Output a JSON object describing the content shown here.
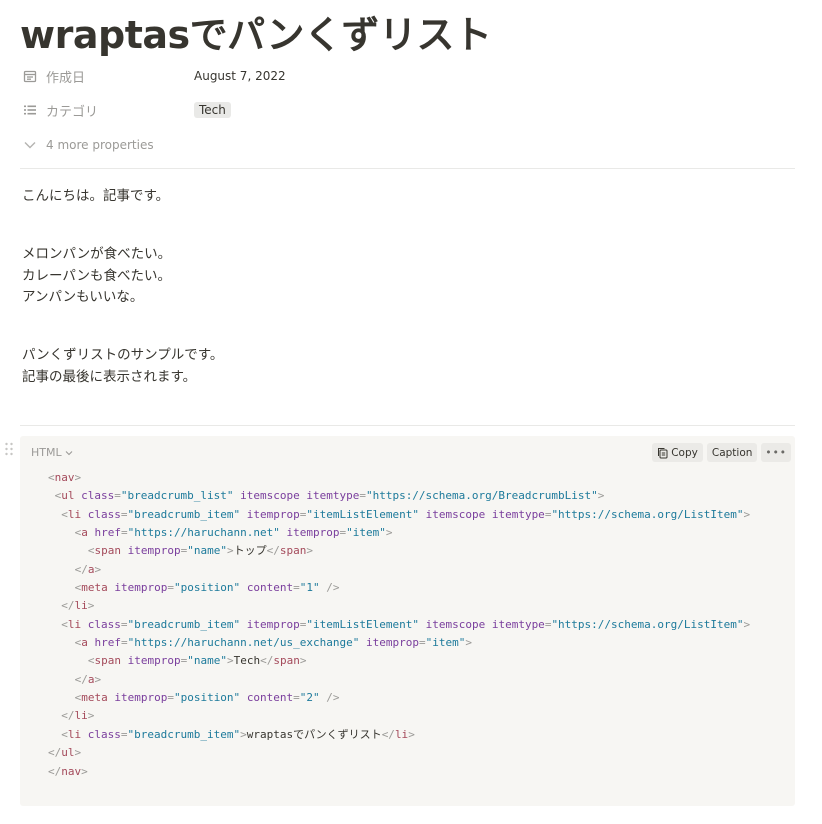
{
  "page": {
    "title": "wraptasでパンくずリスト"
  },
  "properties": {
    "created": {
      "icon": "calendar-icon",
      "name": "作成日",
      "value": "August 7, 2022"
    },
    "category": {
      "icon": "list-icon",
      "name": "カテゴリ",
      "tag": "Tech"
    },
    "more": {
      "icon": "chevron-down-icon",
      "label": "4 more properties"
    }
  },
  "content": {
    "p1": "こんにちは。記事です。",
    "p2": [
      "メロンパンが食べたい。",
      "カレーパンも食べたい。",
      "アンパンもいいな。"
    ],
    "p3": [
      "パンくずリストのサンプルです。",
      "記事の最後に表示されます。"
    ]
  },
  "code_block": {
    "language": "HTML",
    "copy_label": "Copy",
    "caption_label": "Caption",
    "more_label": "•••",
    "lines": [
      {
        "indent": 0,
        "tokens": [
          [
            "pun",
            "<"
          ],
          [
            "tag",
            "nav"
          ],
          [
            "pun",
            ">"
          ]
        ]
      },
      {
        "indent": 1,
        "tokens": [
          [
            "pun",
            "<"
          ],
          [
            "tag",
            "ul"
          ],
          [
            "txt",
            " "
          ],
          [
            "attr",
            "class"
          ],
          [
            "pun",
            "="
          ],
          [
            "val",
            "\"breadcrumb_list\""
          ],
          [
            "txt",
            " "
          ],
          [
            "attr",
            "itemscope"
          ],
          [
            "txt",
            " "
          ],
          [
            "attr",
            "itemtype"
          ],
          [
            "pun",
            "="
          ],
          [
            "val",
            "\"https://schema.org/BreadcrumbList\""
          ],
          [
            "pun",
            ">"
          ]
        ]
      },
      {
        "indent": 2,
        "tokens": [
          [
            "pun",
            "<"
          ],
          [
            "tag",
            "li"
          ],
          [
            "txt",
            " "
          ],
          [
            "attr",
            "class"
          ],
          [
            "pun",
            "="
          ],
          [
            "val",
            "\"breadcrumb_item\""
          ],
          [
            "txt",
            " "
          ],
          [
            "attr",
            "itemprop"
          ],
          [
            "pun",
            "="
          ],
          [
            "val",
            "\"itemListElement\""
          ],
          [
            "txt",
            " "
          ],
          [
            "attr",
            "itemscope"
          ],
          [
            "txt",
            " "
          ],
          [
            "attr",
            "itemtype"
          ],
          [
            "pun",
            "="
          ],
          [
            "val",
            "\"https://schema.org/ListItem\""
          ],
          [
            "pun",
            ">"
          ]
        ]
      },
      {
        "indent": 4,
        "tokens": [
          [
            "pun",
            "<"
          ],
          [
            "tag",
            "a"
          ],
          [
            "txt",
            " "
          ],
          [
            "attr",
            "href"
          ],
          [
            "pun",
            "="
          ],
          [
            "val",
            "\"https://haruchann.net\""
          ],
          [
            "txt",
            " "
          ],
          [
            "attr",
            "itemprop"
          ],
          [
            "pun",
            "="
          ],
          [
            "val",
            "\"item\""
          ],
          [
            "pun",
            ">"
          ]
        ]
      },
      {
        "indent": 6,
        "tokens": [
          [
            "pun",
            "<"
          ],
          [
            "tag",
            "span"
          ],
          [
            "txt",
            " "
          ],
          [
            "attr",
            "itemprop"
          ],
          [
            "pun",
            "="
          ],
          [
            "val",
            "\"name\""
          ],
          [
            "pun",
            ">"
          ],
          [
            "txt",
            "トップ"
          ],
          [
            "pun",
            "</"
          ],
          [
            "tag",
            "span"
          ],
          [
            "pun",
            ">"
          ]
        ]
      },
      {
        "indent": 4,
        "tokens": [
          [
            "pun",
            "</"
          ],
          [
            "tag",
            "a"
          ],
          [
            "pun",
            ">"
          ]
        ]
      },
      {
        "indent": 4,
        "tokens": [
          [
            "pun",
            "<"
          ],
          [
            "tag",
            "meta"
          ],
          [
            "txt",
            " "
          ],
          [
            "attr",
            "itemprop"
          ],
          [
            "pun",
            "="
          ],
          [
            "val",
            "\"position\""
          ],
          [
            "txt",
            " "
          ],
          [
            "attr",
            "content"
          ],
          [
            "pun",
            "="
          ],
          [
            "val",
            "\"1\""
          ],
          [
            "txt",
            " "
          ],
          [
            "pun",
            "/>"
          ]
        ]
      },
      {
        "indent": 2,
        "tokens": [
          [
            "pun",
            "</"
          ],
          [
            "tag",
            "li"
          ],
          [
            "pun",
            ">"
          ]
        ]
      },
      {
        "indent": 2,
        "tokens": [
          [
            "pun",
            "<"
          ],
          [
            "tag",
            "li"
          ],
          [
            "txt",
            " "
          ],
          [
            "attr",
            "class"
          ],
          [
            "pun",
            "="
          ],
          [
            "val",
            "\"breadcrumb_item\""
          ],
          [
            "txt",
            " "
          ],
          [
            "attr",
            "itemprop"
          ],
          [
            "pun",
            "="
          ],
          [
            "val",
            "\"itemListElement\""
          ],
          [
            "txt",
            " "
          ],
          [
            "attr",
            "itemscope"
          ],
          [
            "txt",
            " "
          ],
          [
            "attr",
            "itemtype"
          ],
          [
            "pun",
            "="
          ],
          [
            "val",
            "\"https://schema.org/ListItem\""
          ],
          [
            "pun",
            ">"
          ]
        ]
      },
      {
        "indent": 4,
        "tokens": [
          [
            "pun",
            "<"
          ],
          [
            "tag",
            "a"
          ],
          [
            "txt",
            " "
          ],
          [
            "attr",
            "href"
          ],
          [
            "pun",
            "="
          ],
          [
            "val",
            "\"https://haruchann.net/us_exchange\""
          ],
          [
            "txt",
            " "
          ],
          [
            "attr",
            "itemprop"
          ],
          [
            "pun",
            "="
          ],
          [
            "val",
            "\"item\""
          ],
          [
            "pun",
            ">"
          ]
        ]
      },
      {
        "indent": 6,
        "tokens": [
          [
            "pun",
            "<"
          ],
          [
            "tag",
            "span"
          ],
          [
            "txt",
            " "
          ],
          [
            "attr",
            "itemprop"
          ],
          [
            "pun",
            "="
          ],
          [
            "val",
            "\"name\""
          ],
          [
            "pun",
            ">"
          ],
          [
            "txt",
            "Tech"
          ],
          [
            "pun",
            "</"
          ],
          [
            "tag",
            "span"
          ],
          [
            "pun",
            ">"
          ]
        ]
      },
      {
        "indent": 4,
        "tokens": [
          [
            "pun",
            "</"
          ],
          [
            "tag",
            "a"
          ],
          [
            "pun",
            ">"
          ]
        ]
      },
      {
        "indent": 4,
        "tokens": [
          [
            "pun",
            "<"
          ],
          [
            "tag",
            "meta"
          ],
          [
            "txt",
            " "
          ],
          [
            "attr",
            "itemprop"
          ],
          [
            "pun",
            "="
          ],
          [
            "val",
            "\"position\""
          ],
          [
            "txt",
            " "
          ],
          [
            "attr",
            "content"
          ],
          [
            "pun",
            "="
          ],
          [
            "val",
            "\"2\""
          ],
          [
            "txt",
            " "
          ],
          [
            "pun",
            "/>"
          ]
        ]
      },
      {
        "indent": 2,
        "tokens": [
          [
            "pun",
            "</"
          ],
          [
            "tag",
            "li"
          ],
          [
            "pun",
            ">"
          ]
        ]
      },
      {
        "indent": 2,
        "tokens": [
          [
            "pun",
            "<"
          ],
          [
            "tag",
            "li"
          ],
          [
            "txt",
            " "
          ],
          [
            "attr",
            "class"
          ],
          [
            "pun",
            "="
          ],
          [
            "val",
            "\"breadcrumb_item\""
          ],
          [
            "pun",
            ">"
          ],
          [
            "txt",
            "wraptasでパンくずリスト"
          ],
          [
            "pun",
            "</"
          ],
          [
            "tag",
            "li"
          ],
          [
            "pun",
            ">"
          ]
        ]
      },
      {
        "indent": 0,
        "tokens": [
          [
            "pun",
            "</"
          ],
          [
            "tag",
            "ul"
          ],
          [
            "pun",
            ">"
          ]
        ]
      },
      {
        "indent": 0,
        "tokens": [
          [
            "pun",
            "</"
          ],
          [
            "tag",
            "nav"
          ],
          [
            "pun",
            ">"
          ]
        ]
      }
    ]
  }
}
